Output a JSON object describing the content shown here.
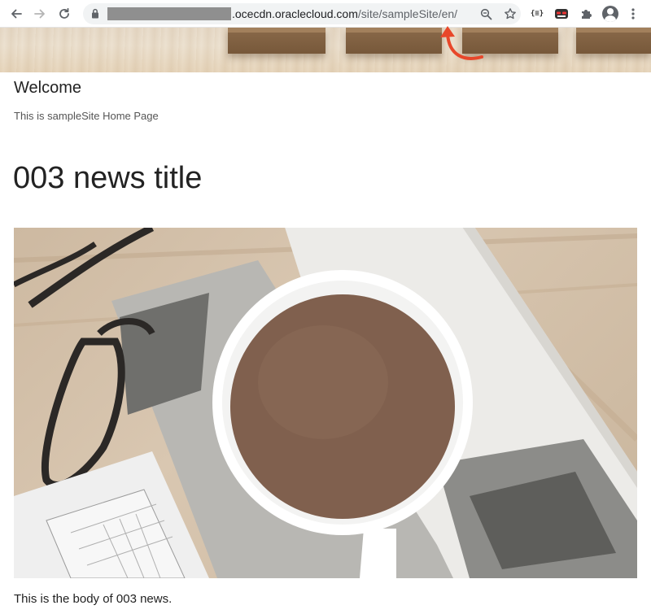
{
  "browser": {
    "url_host": ".ocecdn.oraclecloud.com",
    "url_path": "/site/sampleSite/en/",
    "icons": [
      "back-arrow-icon",
      "forward-arrow-icon",
      "reload-icon",
      "lock-icon",
      "zoom-icon",
      "star-icon",
      "json-extension-icon",
      "incognito-extension-icon",
      "puzzle-icon",
      "profile-icon",
      "more-vert-icon"
    ],
    "json_extension_label": "{≡}",
    "annotation_color": "#e8472a"
  },
  "page": {
    "welcome": "Welcome",
    "subtitle": "This is sampleSite Home Page",
    "news_title": "003 news title",
    "news_body": "This is the body of 003 news."
  }
}
